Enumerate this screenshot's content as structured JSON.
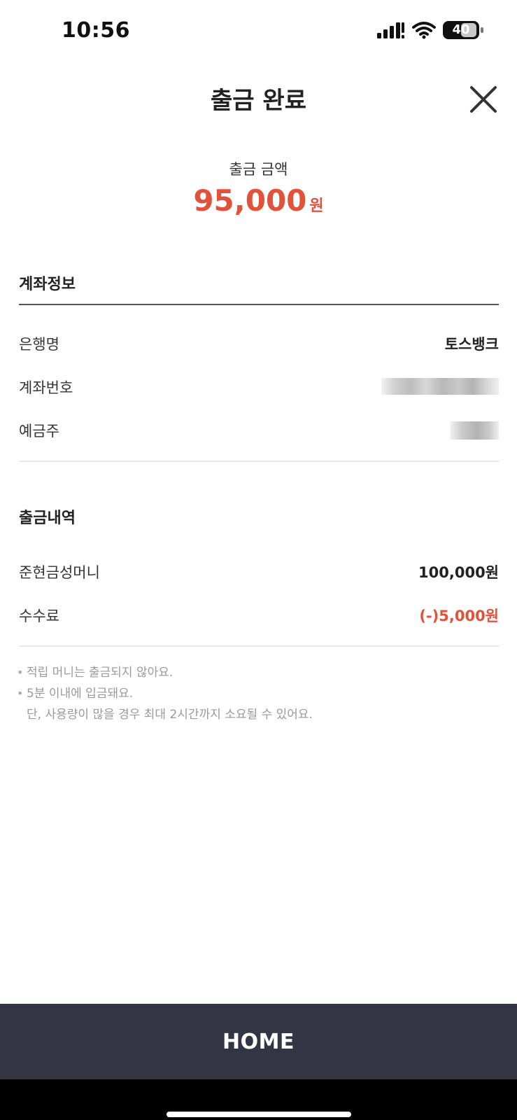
{
  "status_bar": {
    "time": "10:56",
    "battery": "40"
  },
  "header": {
    "title": "출금 완료",
    "close_icon": "close-icon"
  },
  "amount": {
    "label": "출금 금액",
    "value": "95,000",
    "unit": "원",
    "color": "#e2523a"
  },
  "account_info": {
    "section_title": "계좌정보",
    "rows": [
      {
        "label": "은행명",
        "value": "토스뱅크"
      },
      {
        "label": "계좌번호"
      },
      {
        "label": "예금주"
      }
    ]
  },
  "withdraw_details": {
    "section_title": "출금내역",
    "rows": [
      {
        "label": "준현금성머니",
        "value": "100,000원"
      },
      {
        "label": "수수료",
        "value": "(-)5,000원"
      }
    ]
  },
  "notes": {
    "items": [
      "적립 머니는 출금되지 않아요.",
      "5분 이내에 입금돼요."
    ],
    "sub": "단, 사용량이 많을 경우 최대 2시간까지 소요될 수 있어요."
  },
  "home_button": {
    "label": "HOME",
    "background": "#333544"
  }
}
